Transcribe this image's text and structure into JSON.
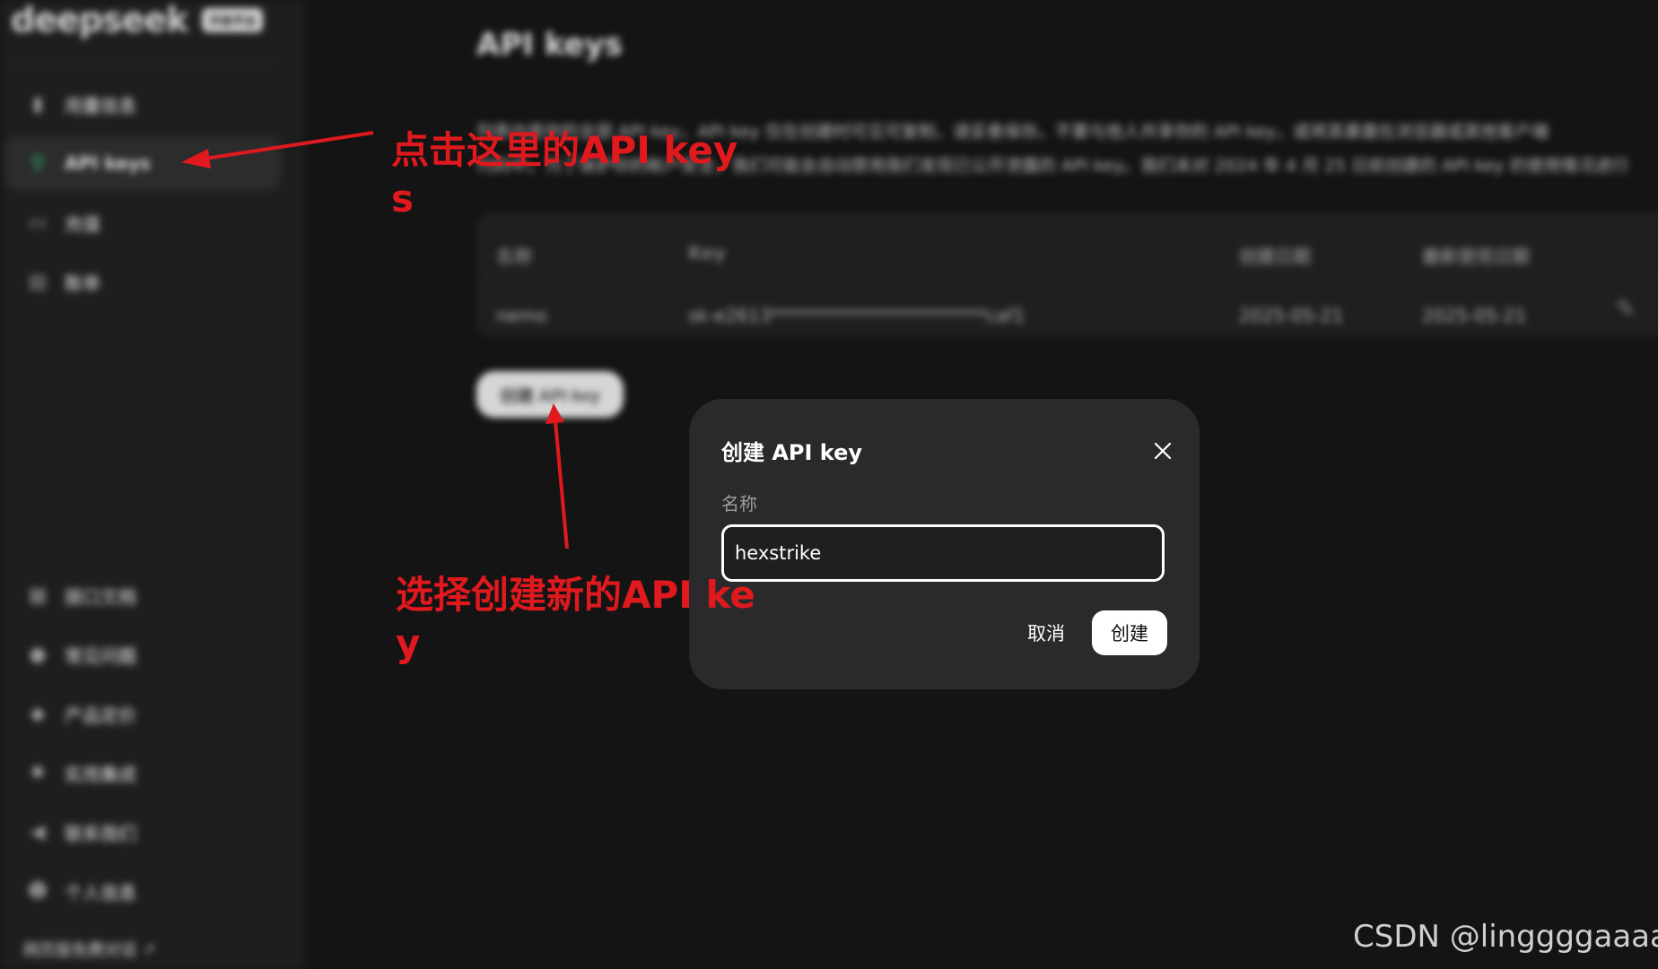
{
  "sidebar": {
    "brand": "deepseek",
    "badge": "开放平台",
    "items": [
      {
        "label": "用量信息",
        "icon": "bar-chart-icon"
      },
      {
        "label": "API keys",
        "icon": "key-search-icon"
      },
      {
        "label": "充值",
        "icon": "wallet-icon"
      },
      {
        "label": "账单",
        "icon": "receipt-icon"
      }
    ],
    "bottom_items": [
      {
        "label": "接口文档",
        "icon": "document-icon"
      },
      {
        "label": "常见问题",
        "icon": "help-icon"
      },
      {
        "label": "产品定价",
        "icon": "price-tag-icon"
      },
      {
        "label": "实用集成",
        "icon": "integration-icon"
      },
      {
        "label": "联系我们",
        "icon": "megaphone-icon"
      },
      {
        "label": "个人信息",
        "icon": "user-icon"
      }
    ],
    "footer_link": "网页版免费对话 ↗"
  },
  "main": {
    "title": "API keys",
    "description_line1": "列表内是你的全部 API key，API key 仅在创建时可见可复制，请妥善保存。不要与他人共享你的 API key，或将其暴露在浏览器或其他客户端",
    "description_line2": "代码中。为了保护你的帐户安全，我们可能会自动禁用我们发现已公开泄露的 API key。我们未对 2024 年 4 月 25 日前创建的 API key 的使用情况进行",
    "table": {
      "headers": [
        "名称",
        "Key",
        "创建日期",
        "最新使用日期"
      ],
      "rows": [
        {
          "name": "nemo",
          "key": "sk-e2613************************caf1",
          "created": "2025-05-21",
          "last_used": "2025-05-21"
        }
      ]
    },
    "create_button": "创建 API key"
  },
  "modal": {
    "title": "创建 API key",
    "name_label": "名称",
    "name_value": "hexstrike",
    "cancel_label": "取消",
    "create_label": "创建"
  },
  "annotations": {
    "click_api_keys": "点击这里的API key\ns",
    "choose_create": "选择创建新的API ke\ny",
    "color": "#e0191e"
  },
  "watermark": "CSDN @linggggaaaa"
}
